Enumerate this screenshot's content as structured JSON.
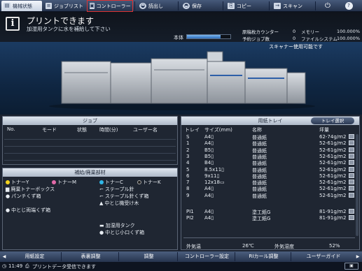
{
  "tabs": [
    {
      "label": "機械状態",
      "icon": "machine-icon"
    },
    {
      "label": "ジョブリスト",
      "icon": "job-list-icon"
    },
    {
      "label": "コントローラー",
      "icon": "controller-icon"
    },
    {
      "label": "読出し",
      "icon": "read-icon"
    },
    {
      "label": "保存",
      "icon": "save-icon"
    },
    {
      "label": "コピー",
      "icon": "copy-icon"
    },
    {
      "label": "スキャン",
      "icon": "scan-icon"
    },
    {
      "label": "⏻",
      "icon": "power-icon"
    },
    {
      "label": "?",
      "icon": "help-icon"
    }
  ],
  "message": {
    "title": "プリントできます",
    "subtitle": "加湿用タンクに水を補給して下さい",
    "main_body_label": "本体",
    "main_body_progress": 0.78
  },
  "counters": [
    {
      "label": "原稿枚カウンター",
      "value": "0",
      "label2": "メモリー",
      "value2": "100.000%"
    },
    {
      "label": "予約ジョブ数",
      "value": "0",
      "label2": "ファイルシステム",
      "value2": "100.000%"
    }
  ],
  "scanner_message": "スキャナー使用可能です",
  "job_panel": {
    "title": "ジョブ",
    "columns": [
      "No.",
      "モード",
      "状態",
      "時間(分)",
      "ユーザー名"
    ]
  },
  "supply_panel": {
    "title": "補給/廃棄部材",
    "items": [
      {
        "label": "トナーY",
        "color": "#f2d21e"
      },
      {
        "label": "トナーM",
        "color": "#e26aa8"
      },
      {
        "label": "トナーC",
        "color": "#2fb6e6"
      },
      {
        "label": "トナーK",
        "color": "#202020"
      },
      {
        "label": "廃棄トナーボックス"
      },
      {
        "label": "ステープル針"
      },
      {
        "label": "パンチくず箱"
      },
      {
        "label": "ステープル針くず箱"
      },
      {
        "label": "中とじ機受け木"
      },
      {
        "label": "中とじ両端くず箱"
      },
      {
        "label": "加湿用タンク"
      },
      {
        "label": "中とじ小口くず箱"
      }
    ]
  },
  "tray_panel": {
    "title": "用紙トレイ",
    "select_button": "トレイ選択",
    "columns": [
      "トレイ",
      "サイズ(mm)",
      "名称",
      "坪量"
    ],
    "rows": [
      {
        "tray": "S",
        "size": "A4▯",
        "name": "普通紙",
        "weight": "62-74g/m2"
      },
      {
        "tray": "1",
        "size": "A4▯",
        "name": "普通紙",
        "weight": "52-61g/m2"
      },
      {
        "tray": "2",
        "size": "B5▯",
        "name": "普通紙",
        "weight": "52-61g/m2"
      },
      {
        "tray": "3",
        "size": "B5▯",
        "name": "普通紙",
        "weight": "52-61g/m2"
      },
      {
        "tray": "4",
        "size": "B4▯",
        "name": "普通紙",
        "weight": "52-61g/m2"
      },
      {
        "tray": "5",
        "size": "8.5x11▯",
        "name": "普通紙",
        "weight": "52-61g/m2"
      },
      {
        "tray": "6",
        "size": "9x11▯",
        "name": "普通紙",
        "weight": "52-61g/m2"
      },
      {
        "tray": "7",
        "size": "12x18▭",
        "name": "普通紙",
        "weight": "52-61g/m2"
      },
      {
        "tray": "8",
        "size": "A4▯",
        "name": "普通紙",
        "weight": "52-61g/m2"
      },
      {
        "tray": "9",
        "size": "A4▯",
        "name": "普通紙",
        "weight": "52-61g/m2"
      },
      {
        "tray": "PI1",
        "size": "A4▯",
        "name": "塗工紙G",
        "weight": "81-91g/m2"
      },
      {
        "tray": "PI2",
        "size": "A4▯",
        "name": "塗工紙G",
        "weight": "81-91g/m2"
      }
    ],
    "outside_temp_label": "外気温",
    "outside_temp_value": "26℃",
    "outside_humidity_label": "外気湿度",
    "outside_humidity_value": "52%"
  },
  "bottom_buttons": [
    "用紙設定",
    "表裏調整",
    "調整",
    "コントローラー設定",
    "RIカール調整",
    "ユーザーガイド"
  ],
  "status": {
    "time": "11:49",
    "text": "プリントデータ受信できます"
  }
}
